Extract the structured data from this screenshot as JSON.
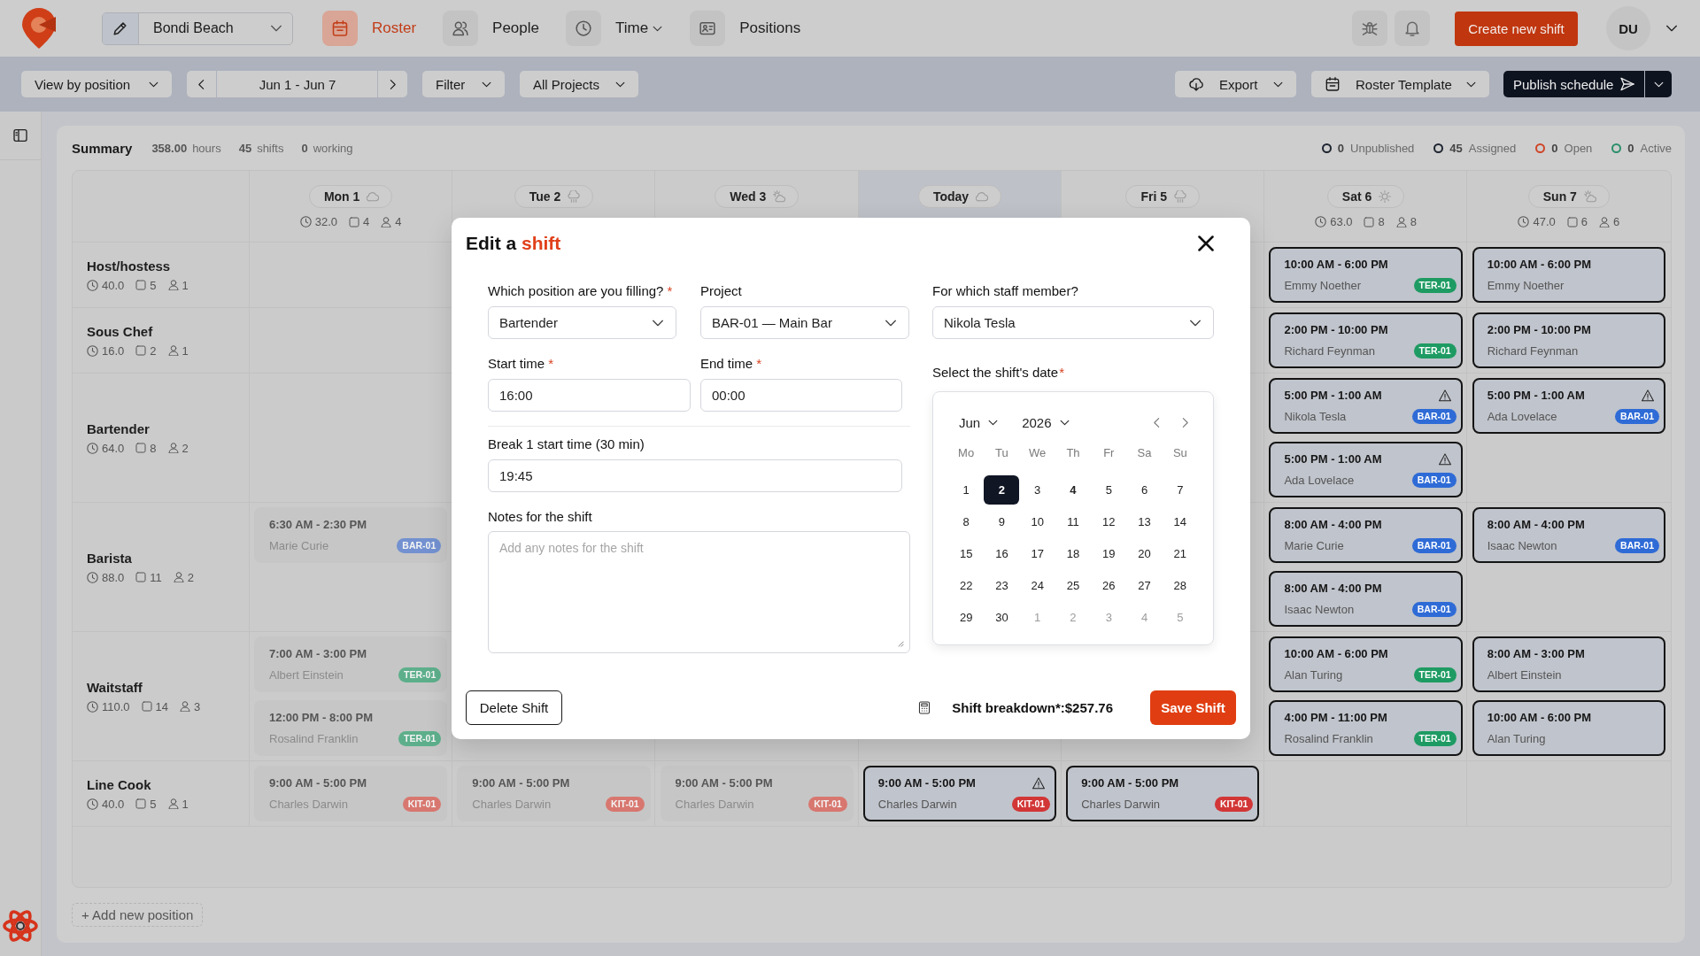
{
  "top_bar": {
    "location": "Bondi Beach",
    "nav": [
      {
        "label": "Roster",
        "selected": true,
        "menu": false
      },
      {
        "label": "People",
        "selected": false,
        "menu": false
      },
      {
        "label": "Time",
        "selected": false,
        "menu": true
      },
      {
        "label": "Positions",
        "selected": false,
        "menu": false
      }
    ],
    "create_button": "Create new shift",
    "avatar": "DU"
  },
  "toolbar": {
    "view": "View by position",
    "range": "Jun 1 - Jun 7",
    "filter": "Filter",
    "projects": "All Projects",
    "export": "Export",
    "template": "Roster Template",
    "publish": "Publish schedule"
  },
  "summary": {
    "title": "Summary",
    "stats": [
      {
        "value": "358.00",
        "unit": "hours"
      },
      {
        "value": "45",
        "unit": "shifts"
      },
      {
        "value": "0",
        "unit": "working"
      }
    ],
    "legend": [
      {
        "count": "0",
        "label": "Unpublished",
        "color": "#1e2430"
      },
      {
        "count": "45",
        "label": "Assigned",
        "color": "#1e2430"
      },
      {
        "count": "0",
        "label": "Open",
        "color": "#cf4527"
      },
      {
        "count": "0",
        "label": "Active",
        "color": "#2a8f6a"
      }
    ]
  },
  "days": [
    {
      "label": "Mon 1",
      "today": false,
      "stats": {
        "hours": "32.0",
        "shifts": "4",
        "staff": "4"
      }
    },
    {
      "label": "Tue 2",
      "today": false
    },
    {
      "label": "Wed 3",
      "today": false
    },
    {
      "label": "Today",
      "today": true
    },
    {
      "label": "Fri 5",
      "today": false
    },
    {
      "label": "Sat 6",
      "today": false,
      "stats": {
        "hours": "63.0",
        "shifts": "8",
        "staff": "8"
      }
    },
    {
      "label": "Sun 7",
      "today": false,
      "stats": {
        "hours": "47.0",
        "shifts": "6",
        "staff": "6"
      }
    }
  ],
  "positions": [
    {
      "name": "Host/hostess",
      "hours": "40.0",
      "shifts": "5",
      "staff": "1",
      "cells": [
        [],
        [],
        [],
        [],
        [],
        [
          {
            "time": "10:00 AM - 6:00 PM",
            "staff": "Emmy Noether",
            "project": "TER-01",
            "color": "#1e9b63",
            "past": false,
            "warning": false
          }
        ],
        [
          {
            "time": "10:00 AM - 6:00 PM",
            "staff": "Emmy Noether",
            "past": false,
            "warning": false
          }
        ]
      ]
    },
    {
      "name": "Sous Chef",
      "hours": "16.0",
      "shifts": "2",
      "staff": "1",
      "cells": [
        [],
        [],
        [],
        [],
        [],
        [
          {
            "time": "2:00 PM - 10:00 PM",
            "staff": "Richard Feynman",
            "project": "TER-01",
            "color": "#1e9b63",
            "past": false,
            "warning": false
          }
        ],
        [
          {
            "time": "2:00 PM - 10:00 PM",
            "staff": "Richard Feynman",
            "past": false,
            "warning": false
          }
        ]
      ]
    },
    {
      "name": "Bartender",
      "hours": "64.0",
      "shifts": "8",
      "staff": "2",
      "cells": [
        [],
        [],
        [],
        [],
        [],
        [
          {
            "time": "5:00 PM - 1:00 AM",
            "staff": "Nikola Tesla",
            "project": "BAR-01",
            "color": "#2e6bd6",
            "past": false,
            "warning": true
          },
          {
            "time": "5:00 PM - 1:00 AM",
            "staff": "Ada Lovelace",
            "project": "BAR-01",
            "color": "#2e6bd6",
            "past": false,
            "warning": true
          }
        ],
        [
          {
            "time": "5:00 PM - 1:00 AM",
            "staff": "Ada Lovelace",
            "project": "BAR-01",
            "color": "#2e6bd6",
            "past": false,
            "warning": true
          }
        ]
      ]
    },
    {
      "name": "Barista",
      "hours": "88.0",
      "shifts": "11",
      "staff": "2",
      "cells": [
        [
          {
            "time": "6:30 AM - 2:30 PM",
            "staff": "Marie Curie",
            "project": "BAR-01",
            "color": "#7391d0",
            "past": true,
            "warning": false
          }
        ],
        [],
        [],
        [],
        [],
        [
          {
            "time": "8:00 AM - 4:00 PM",
            "staff": "Marie Curie",
            "project": "BAR-01",
            "color": "#2e6bd6",
            "past": false,
            "warning": false
          },
          {
            "time": "8:00 AM - 4:00 PM",
            "staff": "Isaac Newton",
            "project": "BAR-01",
            "color": "#2e6bd6",
            "past": false,
            "warning": false
          }
        ],
        [
          {
            "time": "8:00 AM - 4:00 PM",
            "staff": "Isaac Newton",
            "project": "BAR-01",
            "color": "#2e6bd6",
            "past": false,
            "warning": false
          }
        ]
      ]
    },
    {
      "name": "Waitstaff",
      "hours": "110.0",
      "shifts": "14",
      "staff": "3",
      "cells": [
        [
          {
            "time": "7:00 AM - 3:00 PM",
            "staff": "Albert Einstein",
            "project": "TER-01",
            "color": "#5daf8b",
            "past": true,
            "warning": false
          },
          {
            "time": "12:00 PM - 8:00 PM",
            "staff": "Rosalind Franklin",
            "project": "TER-01",
            "color": "#5daf8b",
            "past": true,
            "warning": false
          }
        ],
        [],
        [],
        [],
        [],
        [
          {
            "time": "10:00 AM - 6:00 PM",
            "staff": "Alan Turing",
            "project": "TER-01",
            "color": "#1e9b63",
            "past": false,
            "warning": false
          },
          {
            "time": "4:00 PM - 11:00 PM",
            "staff": "Rosalind Franklin",
            "project": "TER-01",
            "color": "#1e9b63",
            "past": false,
            "warning": false
          }
        ],
        [
          {
            "time": "8:00 AM - 3:00 PM",
            "staff": "Albert Einstein",
            "past": false,
            "warning": false
          },
          {
            "time": "10:00 AM - 6:00 PM",
            "staff": "Alan Turing",
            "past": false,
            "warning": false
          }
        ]
      ]
    },
    {
      "name": "Line Cook",
      "hours": "40.0",
      "shifts": "5",
      "staff": "1",
      "cells": [
        [
          {
            "time": "9:00 AM - 5:00 PM",
            "staff": "Charles Darwin",
            "project": "KIT-01",
            "color": "#d8776f",
            "past": true,
            "warning": false
          }
        ],
        [
          {
            "time": "9:00 AM - 5:00 PM",
            "staff": "Charles Darwin",
            "project": "KIT-01",
            "color": "#d8776f",
            "past": true,
            "warning": false
          }
        ],
        [
          {
            "time": "9:00 AM - 5:00 PM",
            "staff": "Charles Darwin",
            "project": "KIT-01",
            "color": "#d8776f",
            "past": true,
            "warning": false
          }
        ],
        [
          {
            "time": "9:00 AM - 5:00 PM",
            "staff": "Charles Darwin",
            "project": "KIT-01",
            "color": "#d23636",
            "past": false,
            "warning": true
          }
        ],
        [
          {
            "time": "9:00 AM - 5:00 PM",
            "staff": "Charles Darwin",
            "project": "KIT-01",
            "color": "#d23636",
            "past": false,
            "warning": false
          }
        ],
        [],
        []
      ]
    }
  ],
  "add_position": "+ Add new position",
  "modal": {
    "title": "Edit a",
    "title_accent": "shift",
    "position": {
      "label": "Which position are you filling?",
      "required_mark": "*",
      "value": "Bartender"
    },
    "project": {
      "label": "Project",
      "value": "BAR-01 — Main Bar"
    },
    "staff": {
      "label": "For which staff member?",
      "value": "Nikola Tesla"
    },
    "start": {
      "label": "Start time",
      "required_mark": "*",
      "value": "16:00"
    },
    "end": {
      "label": "End time",
      "required_mark": "*",
      "value": "00:00"
    },
    "break": {
      "label": "Break 1 start time (30 min)",
      "value": "19:45"
    },
    "notes": {
      "label": "Notes for the shift",
      "placeholder": "Add any notes for the shift"
    },
    "date": {
      "label": "Select the shift's date",
      "required_mark": "*"
    },
    "calendar": {
      "month": "Jun",
      "year": "2026",
      "weekdays": [
        "Mo",
        "Tu",
        "We",
        "Th",
        "Fr",
        "Sa",
        "Su"
      ],
      "weeks": [
        [
          {
            "day": "1",
            "selected": false,
            "today": false,
            "outside": false
          },
          {
            "day": "2",
            "selected": true,
            "today": false,
            "outside": false
          },
          {
            "day": "3",
            "selected": false,
            "today": false,
            "outside": false
          },
          {
            "day": "4",
            "selected": false,
            "today": true,
            "outside": false
          },
          {
            "day": "5",
            "selected": false,
            "today": false,
            "outside": false
          },
          {
            "day": "6",
            "selected": false,
            "today": false,
            "outside": false
          },
          {
            "day": "7",
            "selected": false,
            "today": false,
            "outside": false
          }
        ],
        [
          {
            "day": "8",
            "selected": false,
            "today": false,
            "outside": false
          },
          {
            "day": "9",
            "selected": false,
            "today": false,
            "outside": false
          },
          {
            "day": "10",
            "selected": false,
            "today": false,
            "outside": false
          },
          {
            "day": "11",
            "selected": false,
            "today": false,
            "outside": false
          },
          {
            "day": "12",
            "selected": false,
            "today": false,
            "outside": false
          },
          {
            "day": "13",
            "selected": false,
            "today": false,
            "outside": false
          },
          {
            "day": "14",
            "selected": false,
            "today": false,
            "outside": false
          }
        ],
        [
          {
            "day": "15",
            "selected": false,
            "today": false,
            "outside": false
          },
          {
            "day": "16",
            "selected": false,
            "today": false,
            "outside": false
          },
          {
            "day": "17",
            "selected": false,
            "today": false,
            "outside": false
          },
          {
            "day": "18",
            "selected": false,
            "today": false,
            "outside": false
          },
          {
            "day": "19",
            "selected": false,
            "today": false,
            "outside": false
          },
          {
            "day": "20",
            "selected": false,
            "today": false,
            "outside": false
          },
          {
            "day": "21",
            "selected": false,
            "today": false,
            "outside": false
          }
        ],
        [
          {
            "day": "22",
            "selected": false,
            "today": false,
            "outside": false
          },
          {
            "day": "23",
            "selected": false,
            "today": false,
            "outside": false
          },
          {
            "day": "24",
            "selected": false,
            "today": false,
            "outside": false
          },
          {
            "day": "25",
            "selected": false,
            "today": false,
            "outside": false
          },
          {
            "day": "26",
            "selected": false,
            "today": false,
            "outside": false
          },
          {
            "day": "27",
            "selected": false,
            "today": false,
            "outside": false
          },
          {
            "day": "28",
            "selected": false,
            "today": false,
            "outside": false
          }
        ],
        [
          {
            "day": "29",
            "selected": false,
            "today": false,
            "outside": false
          },
          {
            "day": "30",
            "selected": false,
            "today": false,
            "outside": false
          },
          {
            "day": "1",
            "selected": false,
            "today": false,
            "outside": true
          },
          {
            "day": "2",
            "selected": false,
            "today": false,
            "outside": true
          },
          {
            "day": "3",
            "selected": false,
            "today": false,
            "outside": true
          },
          {
            "day": "4",
            "selected": false,
            "today": false,
            "outside": true
          },
          {
            "day": "5",
            "selected": false,
            "today": false,
            "outside": true
          }
        ]
      ]
    },
    "delete_button": "Delete Shift",
    "breakdown": "Shift breakdown*:$257.76",
    "save_button": "Save Shift"
  }
}
